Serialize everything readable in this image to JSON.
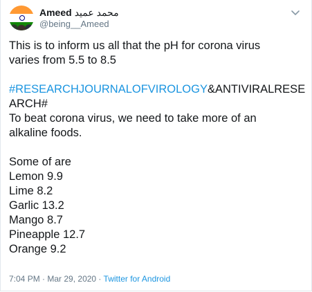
{
  "tweet": {
    "author": {
      "name": "Ameed",
      "name_arabic": "محمد عمید",
      "handle": "@being__Ameed"
    },
    "text": {
      "line1": "This is to inform us all that the pH for corona virus",
      "line2": "varies from 5.5 to 8.5",
      "hashtag": "#RESEARCHJOURNALOFVIROLOGY",
      "hashtag_rest": "&ANTIVIRALRESE",
      "hashtag_line2": "ARCH#",
      "line3": "To beat corona virus, we need to take more of an",
      "line4": "alkaline foods.",
      "list_title": "Some of  are",
      "items": [
        "Lemon  9.9",
        "Lime 8.2",
        "Garlic  13.2",
        "Mango  8.7",
        "Pineapple 12.7",
        "Orange  9.2"
      ]
    },
    "meta": {
      "time": "7:04 PM",
      "separator1": " · ",
      "date": "Mar 29, 2020",
      "separator2": " · ",
      "source": "Twitter for Android"
    },
    "icons": {
      "avatar": "avatar-image",
      "menu": "chevron-down-icon"
    },
    "colors": {
      "link": "#1b95e0",
      "muted": "#657786",
      "text": "#14171a"
    }
  }
}
